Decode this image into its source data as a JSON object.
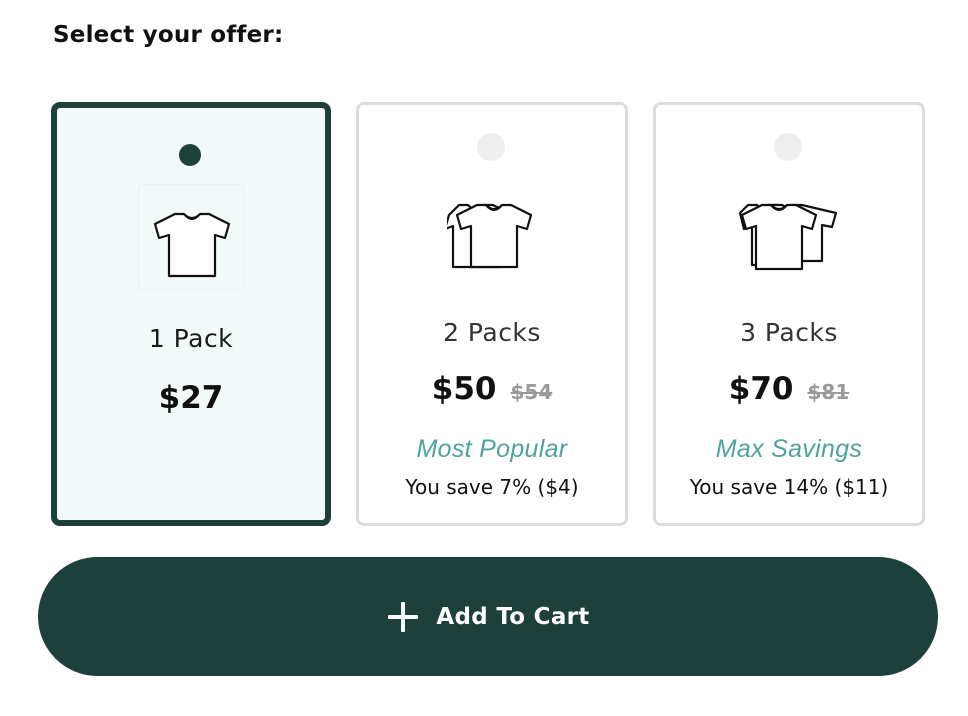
{
  "heading": "Select your offer:",
  "offers": [
    {
      "pack_label": "1 Pack",
      "price": "$27",
      "old_price": "",
      "badge": "",
      "savings": "",
      "selected": true,
      "icon": "single-tshirt-icon"
    },
    {
      "pack_label": "2 Packs",
      "price": "$50",
      "old_price": "$54",
      "badge": "Most Popular",
      "savings": "You save 7% ($4)",
      "selected": false,
      "icon": "two-tshirts-icon"
    },
    {
      "pack_label": "3 Packs",
      "price": "$70",
      "old_price": "$81",
      "badge": "Max Savings",
      "savings": "You save 14% ($11)",
      "selected": false,
      "icon": "three-tshirts-icon"
    }
  ],
  "cart_button": {
    "label": "Add To Cart",
    "icon": "plus-icon"
  },
  "colors": {
    "accent": "#1e403a",
    "badge": "#4fa398",
    "selected_bg": "#f3fafa",
    "border": "#dcdcdc",
    "strikethrough": "#9a9a9a"
  }
}
